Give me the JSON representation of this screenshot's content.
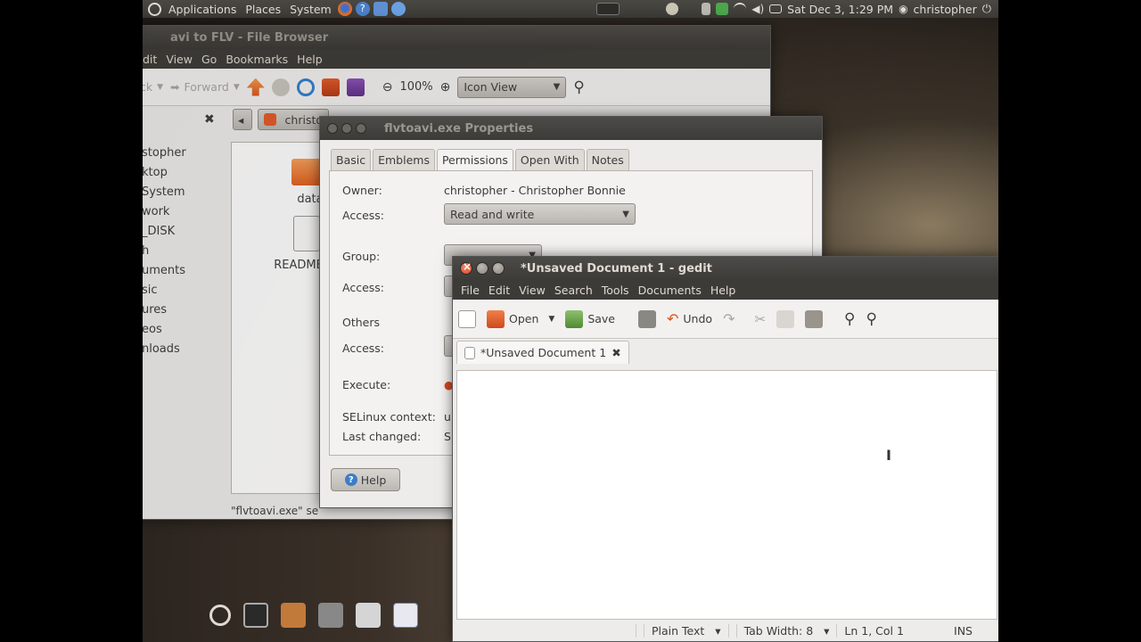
{
  "top_panel": {
    "menu": [
      "Applications",
      "Places",
      "System"
    ],
    "datetime": "Sat Dec  3,  1:29 PM",
    "user": "christopher"
  },
  "file_browser": {
    "title": "avi to FLV - File Browser",
    "menu": [
      "dit",
      "View",
      "Go",
      "Bookmarks",
      "Help"
    ],
    "toolbar": {
      "back": "ck",
      "forward": "Forward",
      "zoom": "100%",
      "view_mode": "Icon View"
    },
    "path_button": "christo",
    "sidebar": [
      "stopher",
      "ktop",
      "System",
      "work",
      "_DISK",
      "h",
      "uments",
      "sic",
      "ures",
      "eos",
      "nloads"
    ],
    "files": [
      {
        "name": "data",
        "icon": "folder-icon"
      },
      {
        "name": "README",
        "icon": "text-file-icon"
      }
    ],
    "status": "\"flvtoavi.exe\" se"
  },
  "properties": {
    "title": "flvtoavi.exe Properties",
    "tabs": [
      "Basic",
      "Emblems",
      "Permissions",
      "Open With",
      "Notes"
    ],
    "active_tab": "Permissions",
    "owner_label": "Owner:",
    "owner_value": "christopher - Christopher Bonnie",
    "access_label": "Access:",
    "owner_access": "Read and write",
    "group_label": "Group:",
    "group_access_label": "Access:",
    "others_label": "Others",
    "others_access_label": "Access:",
    "execute_label": "Execute:",
    "selinux_label": "SELinux context:",
    "selinux_value": "u",
    "last_changed_label": "Last changed:",
    "last_changed_value": "S",
    "help_button": "Help"
  },
  "gedit": {
    "title": "*Unsaved Document 1 - gedit",
    "menu": [
      "File",
      "Edit",
      "View",
      "Search",
      "Tools",
      "Documents",
      "Help"
    ],
    "toolbar": {
      "open": "Open",
      "save": "Save",
      "undo": "Undo"
    },
    "tab_label": "*Unsaved Document 1",
    "status": {
      "language": "Plain Text",
      "tab_width": "Tab Width:  8",
      "position": "Ln 1, Col 1",
      "mode": "INS"
    }
  },
  "colors": {
    "panel_bg": "#3c3b37",
    "window_bg": "#edeceb",
    "close_button": "#d9471e",
    "accent_orange": "#e5622c"
  }
}
